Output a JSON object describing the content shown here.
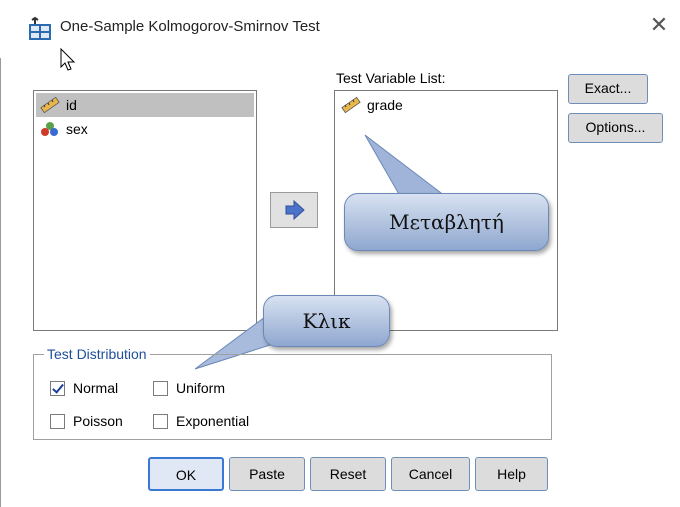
{
  "window": {
    "title": "One-Sample Kolmogorov-Smirnov Test",
    "close_icon": "close-icon"
  },
  "source_list": {
    "items": [
      {
        "label": "id",
        "icon": "scale-ruler-icon",
        "selected": true
      },
      {
        "label": "sex",
        "icon": "nominal-balls-icon",
        "selected": false
      }
    ]
  },
  "target_list": {
    "label": "Test Variable List:",
    "items": [
      {
        "label": "grade",
        "icon": "scale-ruler-icon"
      }
    ]
  },
  "side_buttons": {
    "exact": "Exact...",
    "options": "Options..."
  },
  "callouts": {
    "variable": "Μεταβλητή",
    "click": "Κλικ"
  },
  "test_distribution": {
    "title": "Test Distribution",
    "options": [
      {
        "label": "Normal",
        "checked": true
      },
      {
        "label": "Uniform",
        "checked": false
      },
      {
        "label": "Poisson",
        "checked": false
      },
      {
        "label": "Exponential",
        "checked": false
      }
    ]
  },
  "bottom_buttons": {
    "ok": "OK",
    "paste": "Paste",
    "reset": "Reset",
    "cancel": "Cancel",
    "help": "Help"
  },
  "colors": {
    "callout_gradient_top": "#d8e2f1",
    "callout_gradient_bottom": "#8fa7cf",
    "arrow_button": "#4a73c9",
    "group_title": "#1f4f9a",
    "selection": "#c0c0c0"
  }
}
